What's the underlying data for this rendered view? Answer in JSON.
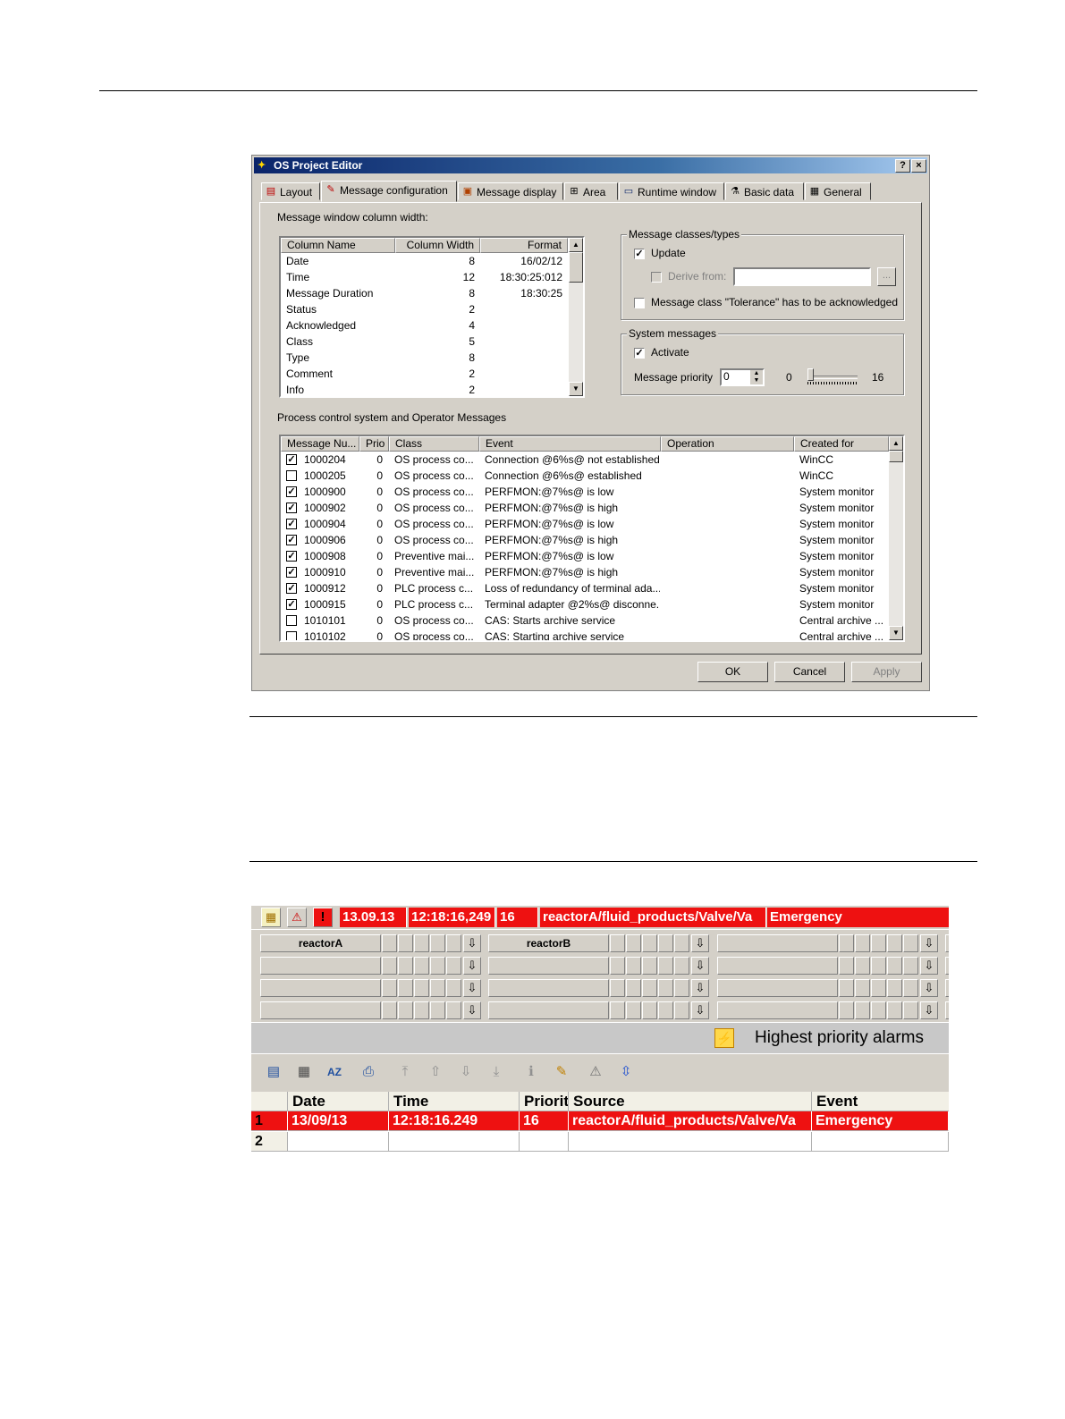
{
  "dialog": {
    "title": "OS Project Editor",
    "help_btn": "?",
    "close_btn": "×",
    "tabs": [
      {
        "label": "Layout",
        "icon": "layout-icon"
      },
      {
        "label": "Message configuration",
        "icon": "message-config-icon"
      },
      {
        "label": "Message display",
        "icon": "message-display-icon"
      },
      {
        "label": "Area",
        "icon": "area-icon"
      },
      {
        "label": "Runtime window",
        "icon": "runtime-window-icon"
      },
      {
        "label": "Basic data",
        "icon": "basic-data-icon"
      },
      {
        "label": "General",
        "icon": "general-icon"
      }
    ],
    "active_tab": "Message configuration",
    "col_width_label": "Message window column width:",
    "col_table": {
      "headers": [
        "Column Name",
        "Column Width",
        "Format"
      ],
      "rows": [
        [
          "Date",
          "8",
          "16/02/12"
        ],
        [
          "Time",
          "12",
          "18:30:25:012"
        ],
        [
          "Message Duration",
          "8",
          "18:30:25"
        ],
        [
          "Status",
          "2",
          ""
        ],
        [
          "Acknowledged",
          "4",
          ""
        ],
        [
          "Class",
          "5",
          ""
        ],
        [
          "Type",
          "8",
          ""
        ],
        [
          "Comment",
          "2",
          ""
        ],
        [
          "Info",
          "2",
          ""
        ]
      ]
    },
    "msg_classes": {
      "group_label": "Message classes/types",
      "update_label": "Update",
      "update_checked": "✓",
      "derive_label": "Derive from:",
      "derive_value": "",
      "browse_label": "...",
      "tolerance_label": "Message class \"Tolerance\" has to be acknowledged"
    },
    "sys_messages": {
      "group_label": "System messages",
      "activate_label": "Activate",
      "activate_checked": "✓",
      "priority_label": "Message priority",
      "priority_value": "0",
      "slider_min": "0",
      "slider_max": "16",
      "slider_level": 0
    },
    "proc_label": "Process control system and Operator Messages",
    "msg_table": {
      "headers": [
        "Message Nu...",
        "Prio",
        "Class",
        "Event",
        "Operation",
        "Created for"
      ],
      "rows": [
        {
          "check": "✓",
          "num": "1000204",
          "prio": "0",
          "cls": "OS process co...",
          "event": "Connection @6%s@ not  established",
          "op": "",
          "created": "WinCC"
        },
        {
          "check": "",
          "num": "1000205",
          "prio": "0",
          "cls": "OS process co...",
          "event": "Connection @6%s@ established",
          "op": "",
          "created": "WinCC"
        },
        {
          "check": "✓",
          "num": "1000900",
          "prio": "0",
          "cls": "OS process co...",
          "event": "PERFMON:@7%s@ is low",
          "op": "",
          "created": "System monitor"
        },
        {
          "check": "✓",
          "num": "1000902",
          "prio": "0",
          "cls": "OS process co...",
          "event": "PERFMON:@7%s@ is high",
          "op": "",
          "created": "System monitor"
        },
        {
          "check": "✓",
          "num": "1000904",
          "prio": "0",
          "cls": "OS process co...",
          "event": "PERFMON:@7%s@ is low",
          "op": "",
          "created": "System monitor"
        },
        {
          "check": "✓",
          "num": "1000906",
          "prio": "0",
          "cls": "OS process co...",
          "event": "PERFMON:@7%s@ is high",
          "op": "",
          "created": "System monitor"
        },
        {
          "check": "✓",
          "num": "1000908",
          "prio": "0",
          "cls": "Preventive mai...",
          "event": "PERFMON:@7%s@ is low",
          "op": "",
          "created": "System monitor"
        },
        {
          "check": "✓",
          "num": "1000910",
          "prio": "0",
          "cls": "Preventive mai...",
          "event": "PERFMON:@7%s@ is high",
          "op": "",
          "created": "System monitor"
        },
        {
          "check": "✓",
          "num": "1000912",
          "prio": "0",
          "cls": "PLC process c...",
          "event": "Loss of redundancy of terminal ada...",
          "op": "",
          "created": "System monitor"
        },
        {
          "check": "✓",
          "num": "1000915",
          "prio": "0",
          "cls": "PLC process c...",
          "event": "Terminal adapter @2%s@ disconne...",
          "op": "",
          "created": "System monitor"
        },
        {
          "check": "",
          "num": "1010101",
          "prio": "0",
          "cls": "OS process co...",
          "event": "CAS: Starts archive service",
          "op": "",
          "created": "Central archive ..."
        },
        {
          "check": "",
          "num": "1010102",
          "prio": "0",
          "cls": "OS process co...",
          "event": "CAS: Starting archive service",
          "op": "",
          "created": "Central archive ..."
        }
      ]
    },
    "buttons": {
      "ok": "OK",
      "cancel": "Cancel",
      "apply": "Apply"
    }
  },
  "alarm_window": {
    "top_line": {
      "date": "13.09.13",
      "time": "12:18:16,249",
      "prio": "16",
      "source": "reactorA/fluid_products/Valve/Va",
      "event": "Emergency"
    },
    "top_icons": [
      "list-icon",
      "alarm-triangle-icon",
      "exclamation-icon"
    ],
    "exclamation": "!",
    "areas": [
      [
        "reactorA",
        "reactorB",
        ""
      ],
      [
        "",
        "",
        ""
      ],
      [
        "",
        "",
        ""
      ],
      [
        "",
        "",
        ""
      ]
    ],
    "area_arrow": "⇩",
    "highest_priority_label": "Highest priority alarms",
    "toolbar_icons": [
      "message-list-icon",
      "printer-grid-icon",
      "sort-az-icon",
      "print-icon",
      "first-page-icon",
      "page-up-icon",
      "page-down-icon",
      "last-page-icon",
      "info-icon",
      "comment-icon",
      "loop-in-alarm-icon",
      "autoscroll-icon"
    ],
    "table": {
      "headers": [
        "",
        "Date",
        "Time",
        "Priorit",
        "Source",
        "Event"
      ],
      "rows": [
        [
          "1",
          "13/09/13",
          "12:18:16.249",
          "16",
          "reactorA/fluid_products/Valve/Va",
          "Emergency"
        ],
        [
          "2",
          "",
          "",
          "",
          "",
          ""
        ]
      ]
    }
  }
}
